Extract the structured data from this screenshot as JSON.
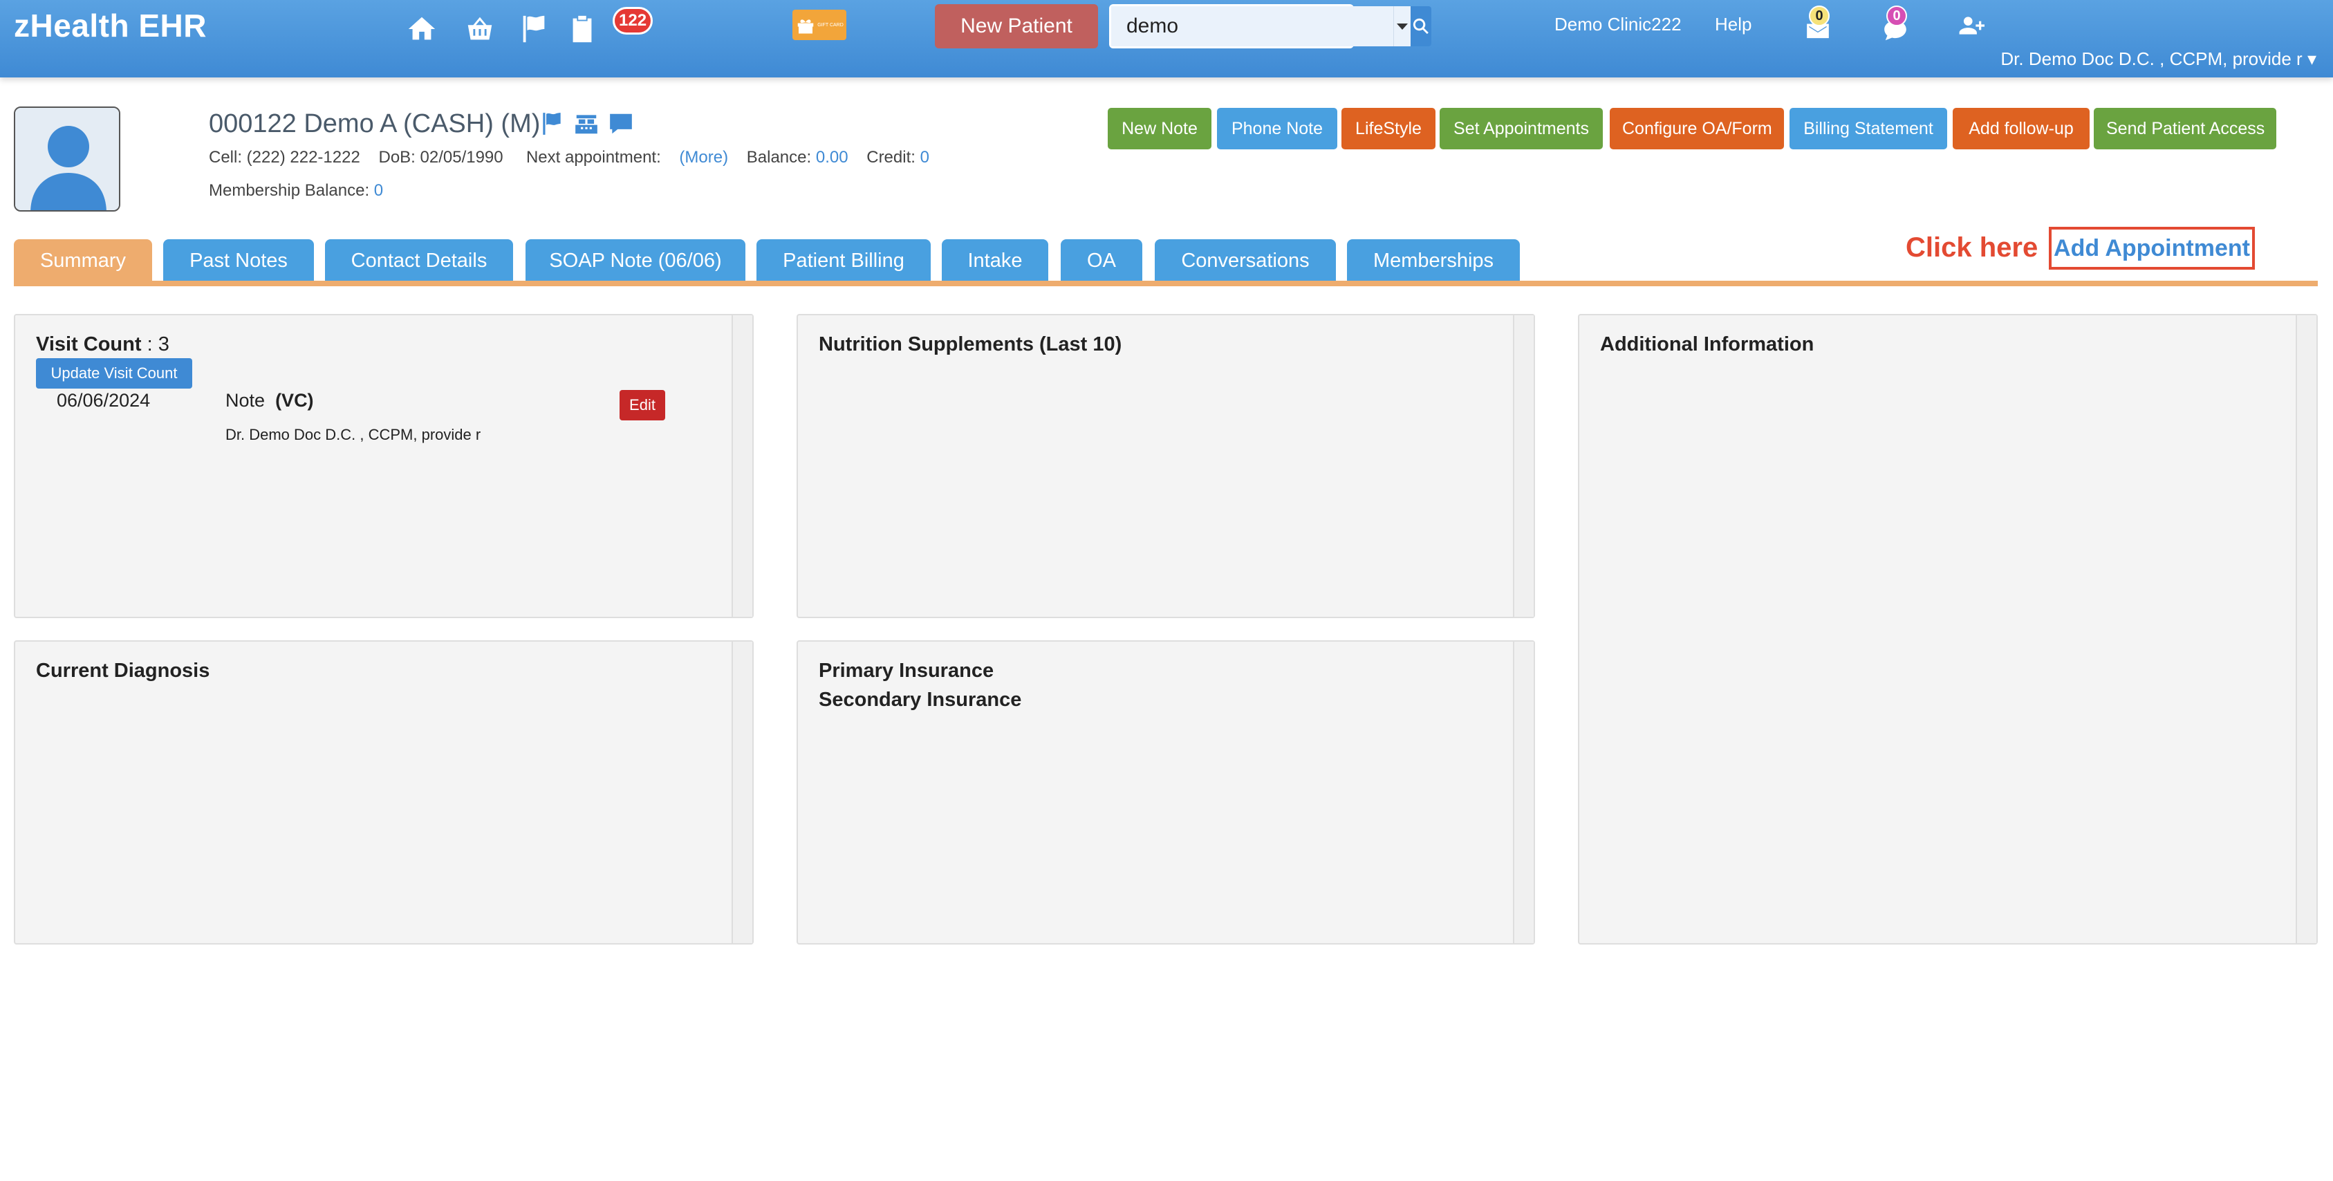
{
  "app": {
    "brand": "zHealth EHR"
  },
  "topbar": {
    "badge_count": "122",
    "new_patient_label": "New Patient",
    "search": {
      "value": "demo",
      "placeholder": ""
    },
    "clinic_link": "Demo Clinic222",
    "help_link": "Help",
    "mail_badge": "0",
    "chat_badge": "0",
    "provider_label": "Dr. Demo Doc D.C. , CCPM, provide r ▾",
    "gift_text": "GIFT CARD",
    "icons": [
      "home-icon",
      "basket-icon",
      "flag-icon",
      "clipboard-icon",
      "gift-icon",
      "mail-icon",
      "chat-icon",
      "add-user-icon"
    ]
  },
  "patient": {
    "name": "000122 Demo A  (CASH) (M)",
    "cell": "Cell: (222) 222-1222",
    "dob": "DoB: 02/05/1990",
    "next_appt_label": "Next appointment:",
    "more_link": "(More)",
    "balance_label": "Balance:",
    "balance_value": "0.00",
    "credit_label": "Credit:",
    "credit_value": "0",
    "membership_label": "Membership Balance:",
    "membership_value": "0"
  },
  "actions": {
    "new_note": "New Note",
    "phone_note": "Phone Note",
    "lifestyle": "LifeStyle",
    "set_appointments": "Set Appointments",
    "configure_oa": "Configure OA/Form",
    "billing_statement": "Billing Statement",
    "add_followup": "Add follow-up",
    "send_access": "Send Patient Access"
  },
  "tabs": [
    {
      "label": "Summary"
    },
    {
      "label": "Past Notes"
    },
    {
      "label": "Contact Details"
    },
    {
      "label": "SOAP Note (06/06)"
    },
    {
      "label": "Patient Billing"
    },
    {
      "label": "Intake"
    },
    {
      "label": "OA"
    },
    {
      "label": "Conversations"
    },
    {
      "label": "Memberships"
    }
  ],
  "callout": {
    "click_here": "Click here",
    "add_appointment": "Add Appointment"
  },
  "visit": {
    "count_label": "Visit Count",
    "count_value": ": 3",
    "update_button": "Update Visit Count",
    "note_date": "06/06/2024",
    "note_label": "Note",
    "note_tag": "(VC)",
    "note_author": "Dr. Demo Doc D.C. , CCPM, provide r",
    "edit_button": "Edit"
  },
  "panels": {
    "nutrition": "Nutrition Supplements (Last 10)",
    "additional": "Additional Information",
    "diagnosis": "Current Diagnosis",
    "primary_ins": "Primary Insurance",
    "secondary_ins": "Secondary Insurance"
  },
  "colors": {
    "header_blue": "#3f8ad4",
    "tab_active": "#eeac6e",
    "green_btn": "#6aa340",
    "orange_btn": "#de6221",
    "callout_red": "#e34a32"
  }
}
